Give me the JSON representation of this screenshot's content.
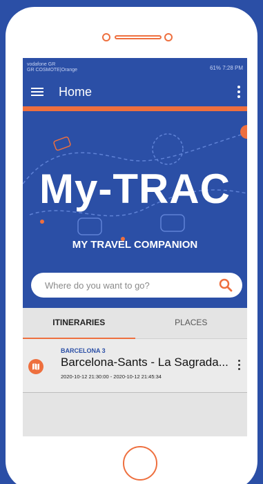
{
  "status": {
    "carrier_line1": "vodafone GR",
    "carrier_line2": "GR COSMOTE|Orange",
    "right": "61% 7:28 PM"
  },
  "appbar": {
    "title": "Home"
  },
  "hero": {
    "logo": "My-TRAC",
    "tagline": "MY TRAVEL COMPANION"
  },
  "search": {
    "placeholder": "Where do you want to go?"
  },
  "tabs": [
    {
      "label": "ITINERARIES",
      "active": true
    },
    {
      "label": "PLACES",
      "active": false
    }
  ],
  "itineraries": [
    {
      "subtitle": "BARCELONA 3",
      "title": "Barcelona-Sants - La Sagrada...",
      "time": "2020-10-12 21:30:00 - 2020-10-12 21:45:34"
    }
  ],
  "colors": {
    "brand_blue": "#2b4fa6",
    "accent_orange": "#ee6f3e"
  }
}
